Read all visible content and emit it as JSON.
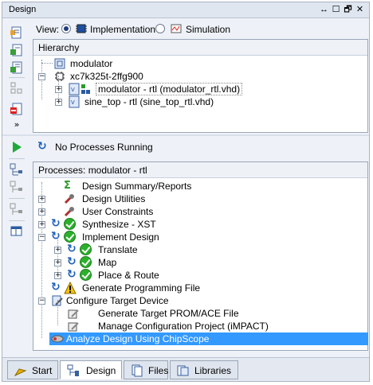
{
  "window": {
    "title": "Design",
    "controls": [
      "↔",
      "☐",
      "🗗",
      "✕"
    ]
  },
  "view": {
    "label": "View:",
    "options": [
      {
        "label": "Implementation",
        "selected": true
      },
      {
        "label": "Simulation",
        "selected": false
      }
    ]
  },
  "hierarchy": {
    "header": "Hierarchy",
    "items": [
      {
        "label": "modulator"
      },
      {
        "label": "xc7k325t-2ffg900"
      },
      {
        "label": "modulator - rtl (modulator_rtl.vhd)"
      },
      {
        "label": "sine_top - rtl (sine_top_rtl.vhd)"
      }
    ]
  },
  "process_status": "No Processes Running",
  "processes": {
    "header": "Processes: modulator - rtl",
    "items": [
      {
        "label": "Design Summary/Reports"
      },
      {
        "label": "Design Utilities"
      },
      {
        "label": "User Constraints"
      },
      {
        "label": "Synthesize - XST"
      },
      {
        "label": "Implement Design"
      },
      {
        "label": "Translate"
      },
      {
        "label": "Map"
      },
      {
        "label": "Place & Route"
      },
      {
        "label": "Generate Programming File"
      },
      {
        "label": "Configure Target Device"
      },
      {
        "label": "Generate Target PROM/ACE File"
      },
      {
        "label": "Manage Configuration Project (iMPACT)"
      },
      {
        "label": "Analyze Design Using ChipScope"
      }
    ]
  },
  "tabs": [
    {
      "label": "Start"
    },
    {
      "label": "Design"
    },
    {
      "label": "Files"
    },
    {
      "label": "Libraries"
    }
  ],
  "colors": {
    "selection": "#3399ff",
    "success": "#2bb02b",
    "warning": "#f5c400"
  }
}
